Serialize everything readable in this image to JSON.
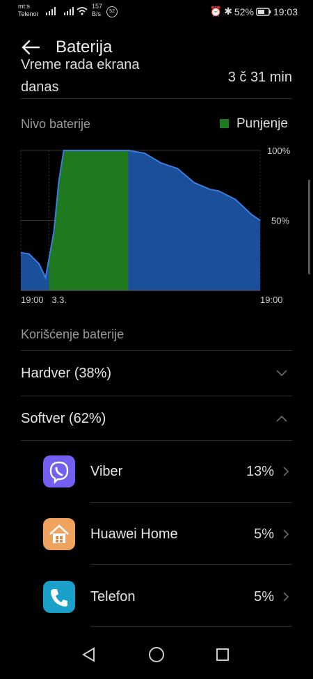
{
  "status": {
    "carrier_line1": "mt:s",
    "carrier_line2": "Telenor",
    "speed_value": "157",
    "speed_unit": "B/s",
    "notif_count": "52",
    "battery_pct": "52%",
    "time": "19:03"
  },
  "header": {
    "title": "Baterija"
  },
  "screen_time": {
    "label_line1": "Vreme rada ekrana",
    "label_line2": "danas",
    "value": "3 č 31 min"
  },
  "battery_level": {
    "label": "Nivo baterije",
    "legend": "Punjenje",
    "charging_color": "#1f7a1f",
    "discharging_color": "#1c4f9a",
    "y_labels": [
      "100%",
      "50%"
    ],
    "x_labels": [
      "19:00",
      "3.3.",
      "19:00"
    ]
  },
  "chart_data": {
    "type": "area",
    "title": "",
    "xlabel": "",
    "ylabel": "",
    "ylim": [
      0,
      100
    ],
    "x_unit": "hours since start (24h window)",
    "points": [
      [
        0,
        27
      ],
      [
        1,
        26
      ],
      [
        2.2,
        19
      ],
      [
        3,
        9
      ],
      [
        4,
        42
      ],
      [
        4.6,
        78
      ],
      [
        5.2,
        100
      ],
      [
        8,
        100
      ],
      [
        13,
        100
      ],
      [
        15,
        98
      ],
      [
        17,
        91
      ],
      [
        19,
        87
      ],
      [
        21,
        77
      ],
      [
        23,
        72
      ],
      [
        24,
        71
      ],
      [
        26,
        65
      ],
      [
        28,
        54
      ],
      [
        29,
        50
      ]
    ],
    "charging_range": [
      3.4,
      13
    ]
  },
  "usage": {
    "label": "Korišćenje baterije",
    "hardware": "Hardver (38%)",
    "software": "Softver (62%)",
    "apps": [
      {
        "name": "Viber",
        "pct": "13%",
        "icon": "viber-icon",
        "color": "#7360f2"
      },
      {
        "name": "Huawei Home",
        "pct": "5%",
        "icon": "home-icon",
        "color": "#f0a35e"
      },
      {
        "name": "Telefon",
        "pct": "5%",
        "icon": "phone-icon",
        "color": "#1ba0c9"
      }
    ]
  }
}
